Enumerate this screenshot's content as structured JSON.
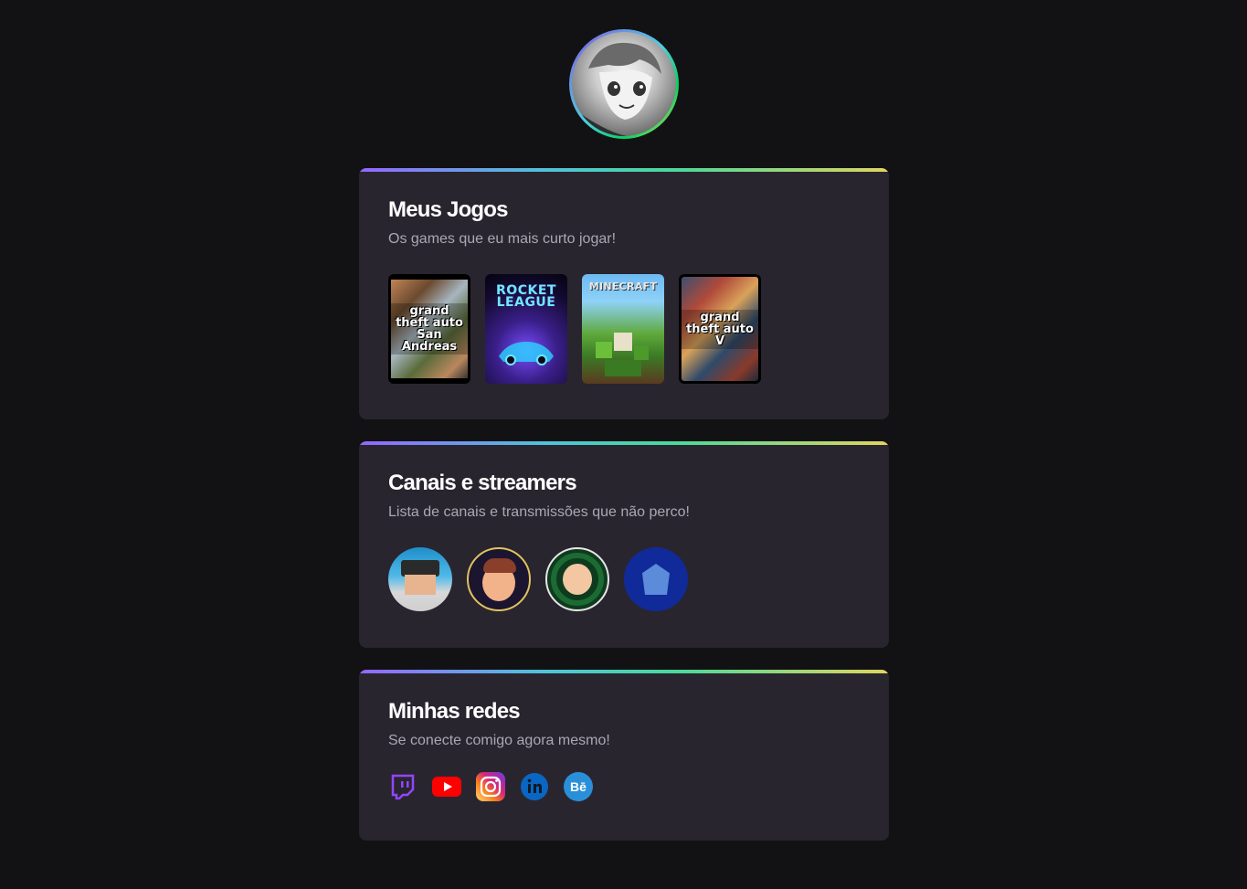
{
  "profile": {
    "avatar_alt": "avatar"
  },
  "games_card": {
    "title": "Meus Jogos",
    "subtitle": "Os games que eu mais curto jogar!",
    "games": [
      {
        "name": "gta-san-andreas",
        "cover_text": "grand theft auto San Andreas"
      },
      {
        "name": "rocket-league",
        "cover_text": "ROCKET LEAGUE"
      },
      {
        "name": "minecraft",
        "cover_text": "MINECRAFT"
      },
      {
        "name": "gta-v",
        "cover_text": "grand theft auto V"
      }
    ]
  },
  "streamers_card": {
    "title": "Canais e streamers",
    "subtitle": "Lista de canais e transmissões que não perco!",
    "streamers": [
      "streamer-1",
      "streamer-2",
      "streamer-3",
      "streamer-4"
    ]
  },
  "socials_card": {
    "title": "Minhas redes",
    "subtitle": "Se conecte comigo agora mesmo!",
    "networks": [
      {
        "icon": "twitch-icon",
        "color": "#9146ff"
      },
      {
        "icon": "youtube-icon",
        "color": "#ff0000"
      },
      {
        "icon": "instagram-icon",
        "color": "#e1306c"
      },
      {
        "icon": "linkedin-icon",
        "color": "#0a66c2"
      },
      {
        "icon": "behance-icon",
        "color": "#1769ff"
      }
    ]
  },
  "colors": {
    "background": "#121214",
    "card": "#29252f",
    "title": "#ffffff",
    "subtitle": "#a8a8b3",
    "gradient": [
      "#9466ff",
      "#4fc3d9",
      "#4ad99a",
      "#e1d55d"
    ]
  }
}
